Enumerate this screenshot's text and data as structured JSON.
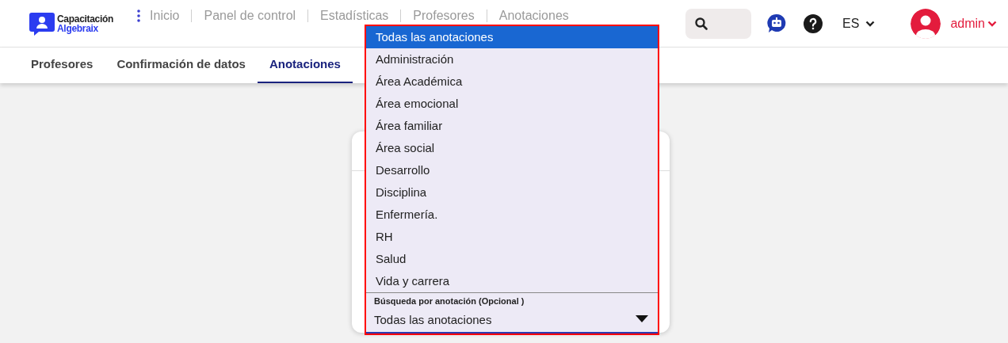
{
  "logo": {
    "line_1": "Capacitación",
    "line_2": "Algebraix"
  },
  "breadcrumb": [
    "Inicio",
    "Panel de control",
    "Estadísticas",
    "Profesores",
    "Anotaciones"
  ],
  "header": {
    "language": "ES",
    "user": "admin"
  },
  "tabs": [
    {
      "label": "Profesores",
      "selected": false
    },
    {
      "label": "Confirmación de datos",
      "selected": false
    },
    {
      "label": "Anotaciones",
      "selected": true
    }
  ],
  "annotation_select": {
    "label": "Búsqueda por anotación (Opcional )",
    "value": "Todas las anotaciones",
    "expanded": true,
    "options": [
      {
        "label": "Todas las anotaciones",
        "selected": true
      },
      {
        "label": "Administración",
        "selected": false
      },
      {
        "label": "Área Académica",
        "selected": false
      },
      {
        "label": "Área emocional",
        "selected": false
      },
      {
        "label": "Área familiar",
        "selected": false
      },
      {
        "label": "Área social",
        "selected": false
      },
      {
        "label": "Desarrollo",
        "selected": false
      },
      {
        "label": "Disciplina",
        "selected": false
      },
      {
        "label": "Enfermería.",
        "selected": false
      },
      {
        "label": "RH",
        "selected": false
      },
      {
        "label": "Salud",
        "selected": false
      },
      {
        "label": "Vida y carrera",
        "selected": false
      }
    ]
  }
}
